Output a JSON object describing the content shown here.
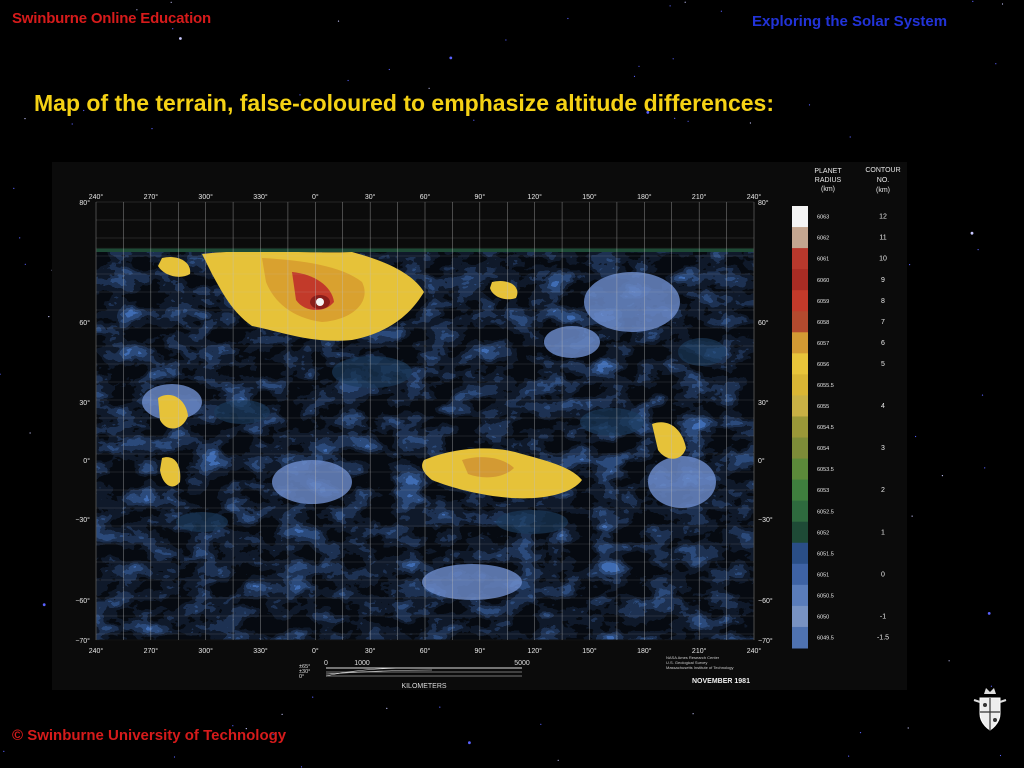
{
  "header": {
    "left": "Swinburne Online Education",
    "right": "Exploring the Solar System"
  },
  "title": "Map of the terrain, false-coloured to emphasize altitude differences:",
  "map": {
    "longitude_labels": [
      "240°",
      "270°",
      "300°",
      "330°",
      "0°",
      "30°",
      "60°",
      "90°",
      "120°",
      "150°",
      "180°",
      "210°",
      "240°"
    ],
    "latitude_labels": [
      "80°",
      "60°",
      "30°",
      "0°",
      "−30°",
      "−60°",
      "−70°"
    ],
    "scale_bar": {
      "lat_marks": [
        "±65°",
        "±30°",
        "0°"
      ],
      "ticks": [
        "0",
        "1000",
        "5000"
      ],
      "unit": "KILOMETERS"
    },
    "credit_lines": [
      "NASA Ames Research Center",
      "U.S. Geological Survey",
      "Massachusetts Institute of Technology"
    ],
    "date": "NOVEMBER 1981",
    "legend": {
      "radius_header": [
        "PLANET",
        "RADIUS",
        "(km)"
      ],
      "contour_header": [
        "CONTOUR",
        "NO.",
        "(km)"
      ],
      "radius_labels": [
        "6063",
        "6062",
        "6061",
        "6060",
        "6059",
        "6058",
        "6057",
        "6056",
        "6055.5",
        "6055",
        "6054.5",
        "6054",
        "6053.5",
        "6053",
        "6052.5",
        "6052",
        "6051.5",
        "6051",
        "6050.5",
        "6050",
        "6049.5"
      ],
      "contour_labels": [
        "12",
        "11",
        "10",
        "9",
        "8",
        "7",
        "6",
        "5",
        "4",
        "3",
        "2",
        "1",
        "0",
        "-1",
        "-1.5"
      ],
      "swatch_colors": [
        "#f4f4f4",
        "#c4a690",
        "#b8382c",
        "#a82c24",
        "#c23a2a",
        "#b34a2e",
        "#d39a33",
        "#e8c43a",
        "#d9b534",
        "#c8b044",
        "#9a9838",
        "#7d8c38",
        "#5c8a3a",
        "#3f7e3e",
        "#2e6a3e",
        "#1e4a36",
        "#2a4e86",
        "#3e62a4",
        "#5a7cba",
        "#7892c2",
        "#4f72b0"
      ]
    }
  },
  "footer": "©  Swinburne University of Technology",
  "colors": {
    "header_red": "#d61b1b",
    "header_blue": "#2233d8",
    "title_yellow": "#f5d215",
    "background": "#000000"
  }
}
